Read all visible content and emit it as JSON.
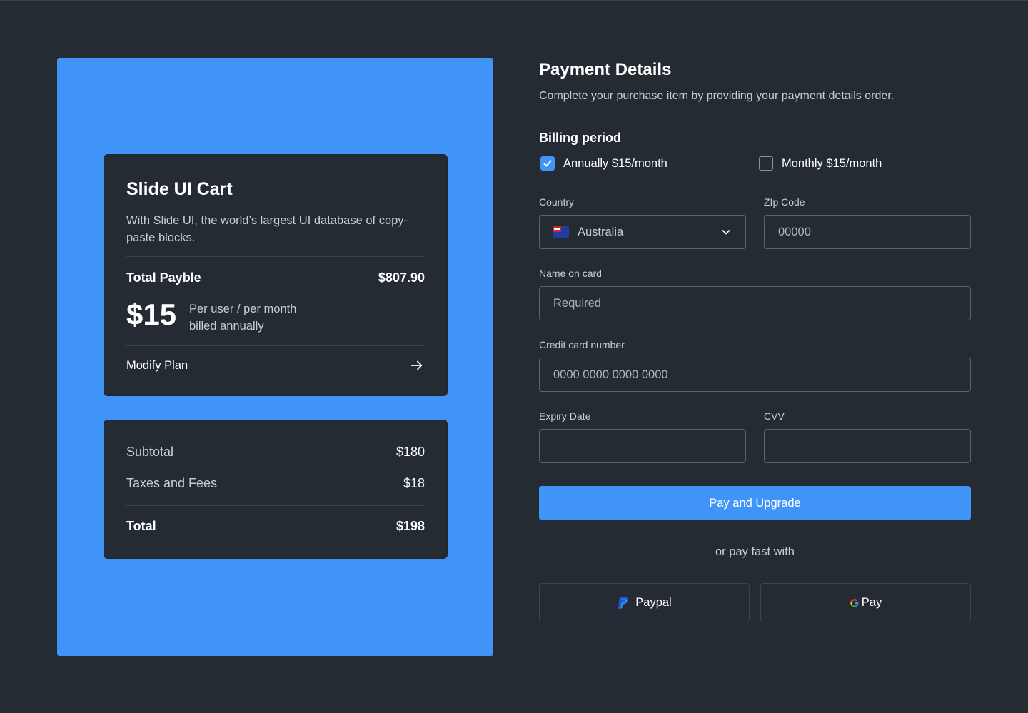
{
  "cart": {
    "title": "Slide UI Cart",
    "description": "With Slide UI, the world’s largest UI database of copy-paste blocks.",
    "total_label": "Total Payble",
    "total_value": "$807.90",
    "price": "$15",
    "price_note_line1": "Per user / per month",
    "price_note_line2": "billed annually",
    "modify_label": "Modify Plan"
  },
  "summary": {
    "subtotal_label": "Subtotal",
    "subtotal_value": "$180",
    "taxes_label": "Taxes and Fees",
    "taxes_value": "$18",
    "total_label": "Total",
    "total_value": "$198"
  },
  "payment": {
    "title": "Payment Details",
    "subtitle": "Complete your purchase item by providing your payment details order.",
    "billing_label": "Billing period",
    "annual_option": "Annually $15/month",
    "annual_checked": true,
    "monthly_option": "Monthly $15/month",
    "monthly_checked": false,
    "country_label": "Country",
    "country_value": "Australia",
    "zip_label": "ZIp Code",
    "zip_placeholder": "00000",
    "name_label": "Name on card",
    "name_placeholder": "Required",
    "card_label": "Credit card number",
    "card_placeholder": "0000 0000 0000 0000",
    "expiry_label": "Expiry Date",
    "cvv_label": "CVV",
    "submit_label": "Pay and Upgrade",
    "or_text": "or pay fast with",
    "paypal_label": "Paypal",
    "gpay_label": "Pay"
  },
  "colors": {
    "background": "#252b33",
    "accent": "#4094f7",
    "card": "#252b33"
  }
}
